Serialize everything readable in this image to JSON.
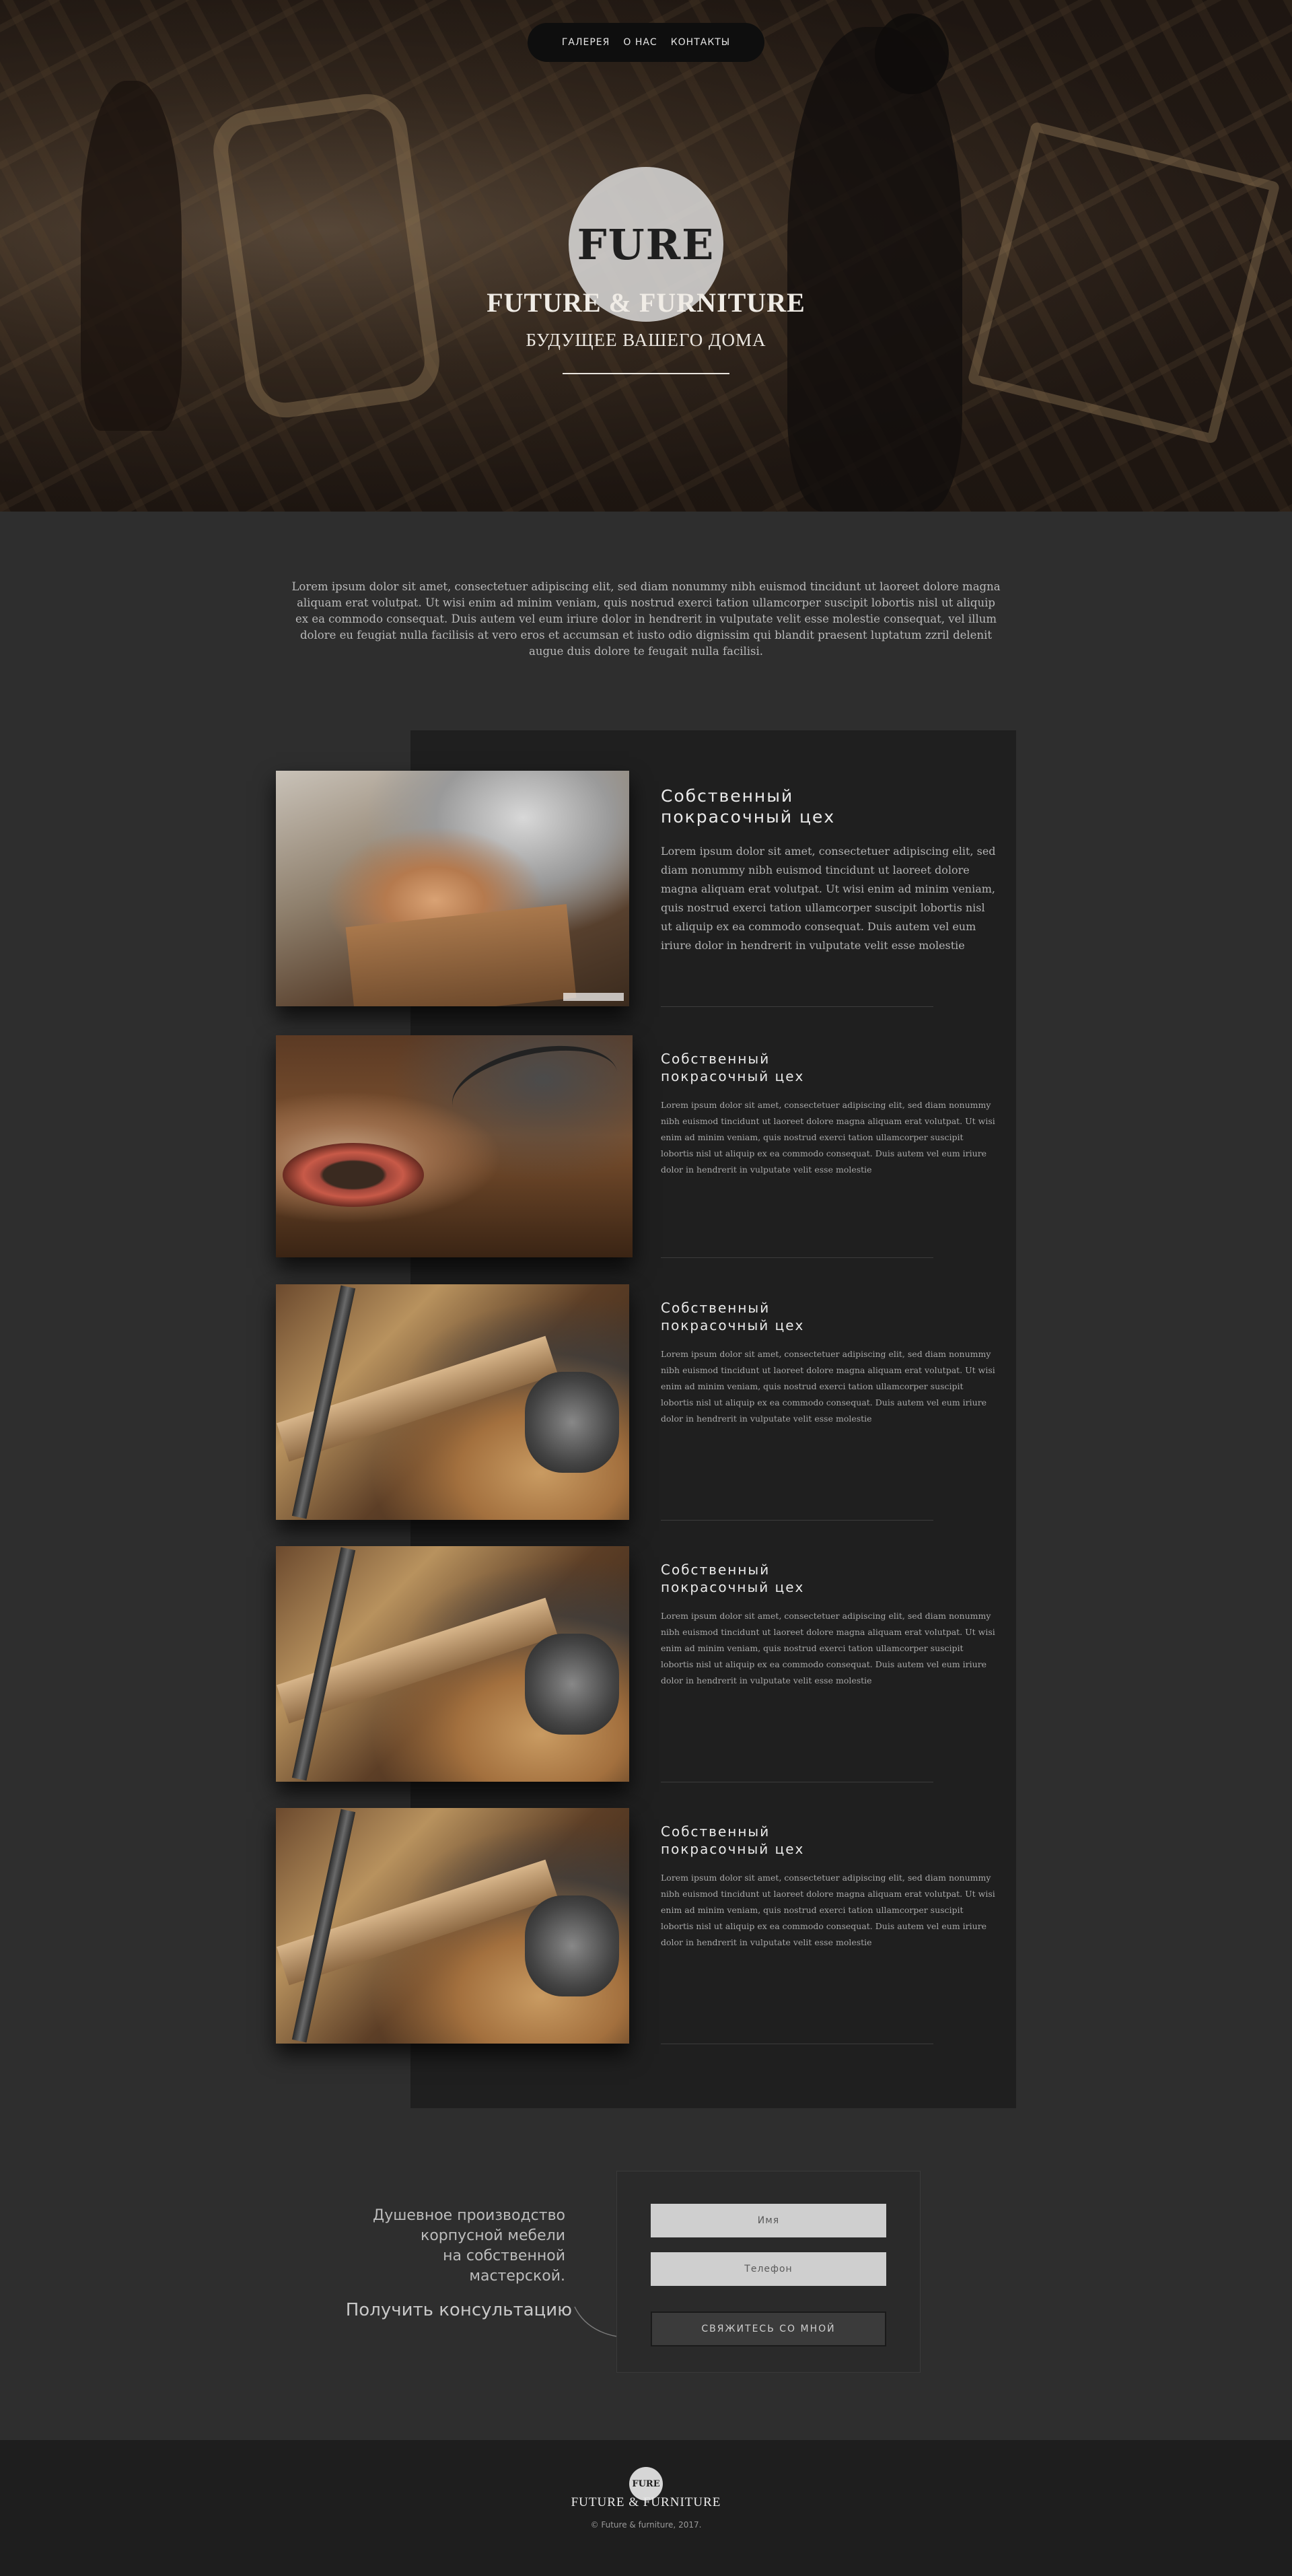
{
  "nav": {
    "items": [
      {
        "label": "ГАЛЕРЕЯ"
      },
      {
        "label": "О НАС"
      },
      {
        "label": "КОНТАКТЫ"
      }
    ]
  },
  "hero": {
    "logo_text": "FURE",
    "title": "FUTURE & FURNITURE",
    "subtitle": "БУДУЩЕЕ ВАШЕГО ДОМА"
  },
  "intro": {
    "text": "Lorem ipsum dolor sit amet, consectetuer adipiscing elit, sed diam nonummy nibh euismod tincidunt ut laoreet dolore magna aliquam erat volutpat. Ut wisi enim ad minim veniam, quis nostrud exerci tation ullamcorper suscipit lobortis nisl ut aliquip ex ea commodo consequat. Duis autem vel eum iriure dolor in hendrerit in vulputate velit esse molestie consequat, vel illum dolore eu feugiat nulla facilisis at vero eros et accumsan et iusto odio dignissim qui blandit praesent luptatum zzril delenit augue duis dolore te feugait nulla facilisi."
  },
  "features": [
    {
      "title_line1": "Собственный",
      "title_line2": "покрасочный цех",
      "text": "Lorem ipsum dolor sit amet, consectetuer adipiscing elit, sed diam nonummy nibh euismod tincidunt ut laoreet dolore magna aliquam erat volutpat. Ut wisi enim ad minim veniam, quis nostrud exerci tation ullamcorper suscipit lobortis nisl ut aliquip ex ea commodo consequat. Duis autem vel eum iriure dolor in hendrerit in vulputate velit esse molestie"
    },
    {
      "title_line1": "Собственный",
      "title_line2": "покрасочный цех",
      "text": "Lorem ipsum dolor sit amet, consectetuer adipiscing elit, sed diam nonummy nibh euismod tincidunt ut laoreet dolore magna aliquam erat volutpat. Ut wisi enim ad minim veniam, quis nostrud exerci tation ullamcorper suscipit lobortis nisl ut aliquip ex ea commodo consequat. Duis autem vel eum iriure dolor in hendrerit in vulputate velit esse molestie"
    },
    {
      "title_line1": "Собственный",
      "title_line2": "покрасочный цех",
      "text": "Lorem ipsum dolor sit amet, consectetuer adipiscing elit, sed diam nonummy nibh euismod tincidunt ut laoreet dolore magna aliquam erat volutpat. Ut wisi enim ad minim veniam, quis nostrud exerci tation ullamcorper suscipit lobortis nisl ut aliquip ex ea commodo consequat. Duis autem vel eum iriure dolor in hendrerit in vulputate velit esse molestie"
    },
    {
      "title_line1": "Собственный",
      "title_line2": "покрасочный цех",
      "text": "Lorem ipsum dolor sit amet, consectetuer adipiscing elit, sed diam nonummy nibh euismod tincidunt ut laoreet dolore magna aliquam erat volutpat. Ut wisi enim ad minim veniam, quis nostrud exerci tation ullamcorper suscipit lobortis nisl ut aliquip ex ea commodo consequat. Duis autem vel eum iriure dolor in hendrerit in vulputate velit esse molestie"
    },
    {
      "title_line1": "Собственный",
      "title_line2": "покрасочный цех",
      "text": "Lorem ipsum dolor sit amet, consectetuer adipiscing elit, sed diam nonummy nibh euismod tincidunt ut laoreet dolore magna aliquam erat volutpat. Ut wisi enim ad minim veniam, quis nostrud exerci tation ullamcorper suscipit lobortis nisl ut aliquip ex ea commodo consequat. Duis autem vel eum iriure dolor in hendrerit in vulputate velit esse molestie"
    }
  ],
  "consult": {
    "pitch_line1": "Душевное производство",
    "pitch_line2": "корпусной мебели",
    "pitch_line3": "на собственной",
    "pitch_line4": "мастерской.",
    "cta_text": "Получить консультацию",
    "name_placeholder": "Имя",
    "phone_placeholder": "Телефон",
    "submit_label": "СВЯЖИТЕСЬ СО МНОЙ"
  },
  "footer": {
    "logo_text": "FURE",
    "title": "FUTURE & FURNITURE",
    "copyright": "© Future & furniture, 2017."
  },
  "colors": {
    "page_bg": "#2e2e2e",
    "panel_bg": "#1f1f1f",
    "footer_bg": "#1e1e1e",
    "nav_bg": "#0e0e0e",
    "input_bg": "#cfcfcf"
  }
}
